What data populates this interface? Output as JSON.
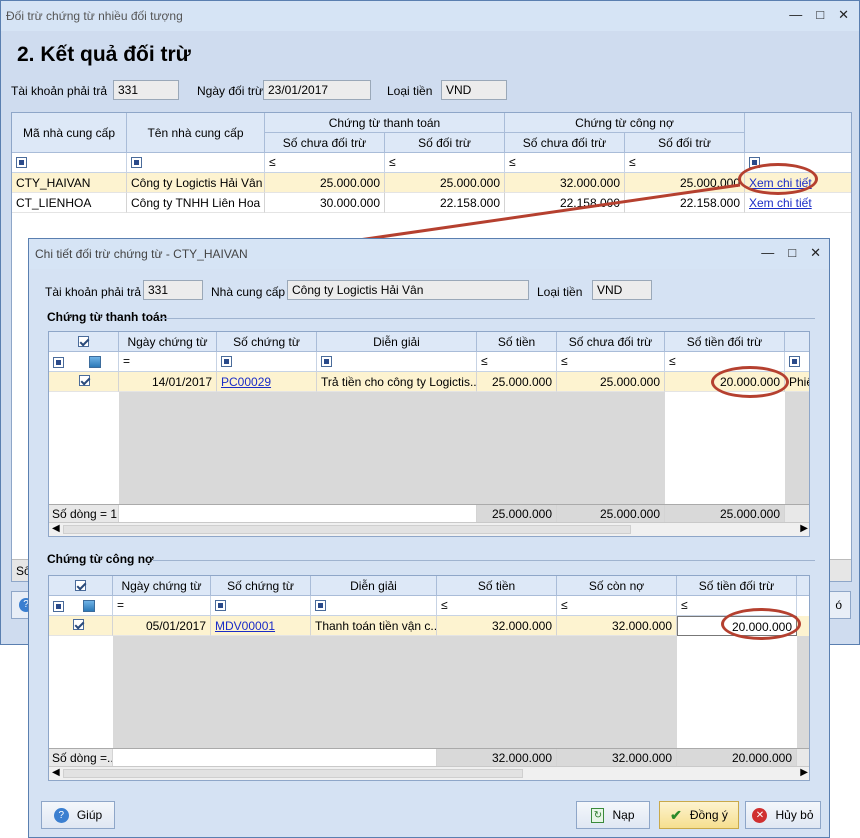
{
  "outer": {
    "title": "Đối trừ chứng từ nhiều đối tượng",
    "heading": "2. Kết quả đối trừ",
    "account_label": "Tài khoản phải trả",
    "account_value": "331",
    "date_label": "Ngày đối trừ",
    "date_value": "23/01/2017",
    "currency_label": "Loại tiền",
    "currency_value": "VND",
    "headers": {
      "supplier_code": "Mã nhà cung cấp",
      "supplier_name": "Tên nhà cung cấp",
      "payment_group": "Chứng từ thanh toán",
      "debt_group": "Chứng từ công nợ",
      "unoffset": "Số chưa đối trừ",
      "offset": "Số đối trừ"
    },
    "filter_op": "≤",
    "rows": [
      {
        "code": "CTY_HAIVAN",
        "name": "Công ty Logictis Hải Vân",
        "pay_unoffset": "25.000.000",
        "pay_offset": "25.000.000",
        "debt_unoffset": "32.000.000",
        "debt_offset": "25.000.000",
        "link": "Xem chi tiết"
      },
      {
        "code": "CT_LIENHOA",
        "name": "Công ty TNHH Liên Hoa",
        "pay_unoffset": "30.000.000",
        "pay_offset": "22.158.000",
        "debt_unoffset": "22.158.000",
        "debt_offset": "22.158.000",
        "link": "Xem chi tiết"
      }
    ],
    "footer_fragment": "Số",
    "help_fragment": "ó"
  },
  "dialog": {
    "title": "Chi tiết đối trừ chứng từ - CTY_HAIVAN",
    "account_label": "Tài khoản phải trả",
    "account_value": "331",
    "supplier_label": "Nhà cung cấp",
    "supplier_value": "Công ty Logictis Hải Vân",
    "currency_label": "Loại tiền",
    "currency_value": "VND",
    "payment": {
      "section_title": "Chứng từ thanh toán",
      "headers": {
        "date": "Ngày chứng từ",
        "voucher": "Số chứng từ",
        "desc": "Diễn giải",
        "amount": "Số tiền",
        "unoffset": "Số chưa đối trừ",
        "offset": "Số tiền đối trừ"
      },
      "filter_eq": "=",
      "filter_le": "≤",
      "row": {
        "date": "14/01/2017",
        "voucher": "PC00029",
        "desc": "Trả tiền cho công ty Logictis...",
        "amount": "25.000.000",
        "unoffset": "25.000.000",
        "offset": "20.000.000",
        "extra": "Phiế"
      },
      "footer": {
        "count": "Số dòng = 1",
        "amount": "25.000.000",
        "unoffset": "25.000.000",
        "offset": "25.000.000"
      }
    },
    "debt": {
      "section_title": "Chứng từ công nợ",
      "headers": {
        "date": "Ngày chứng từ",
        "voucher": "Số chứng từ",
        "desc": "Diễn giải",
        "amount": "Số tiền",
        "remaining": "Số còn nợ",
        "offset": "Số tiền đối trừ"
      },
      "filter_eq": "=",
      "filter_le": "≤",
      "row": {
        "date": "05/01/2017",
        "voucher": "MDV00001",
        "desc": "Thanh toán tiền vận c...",
        "amount": "32.000.000",
        "remaining": "32.000.000",
        "offset": "20.000.000"
      },
      "footer": {
        "count": "Số dòng =...",
        "amount": "32.000.000",
        "remaining": "32.000.000",
        "offset": "20.000.000"
      }
    },
    "buttons": {
      "help": "Giúp",
      "load": "Nạp",
      "ok": "Đồng ý",
      "cancel": "Hủy bỏ"
    }
  }
}
